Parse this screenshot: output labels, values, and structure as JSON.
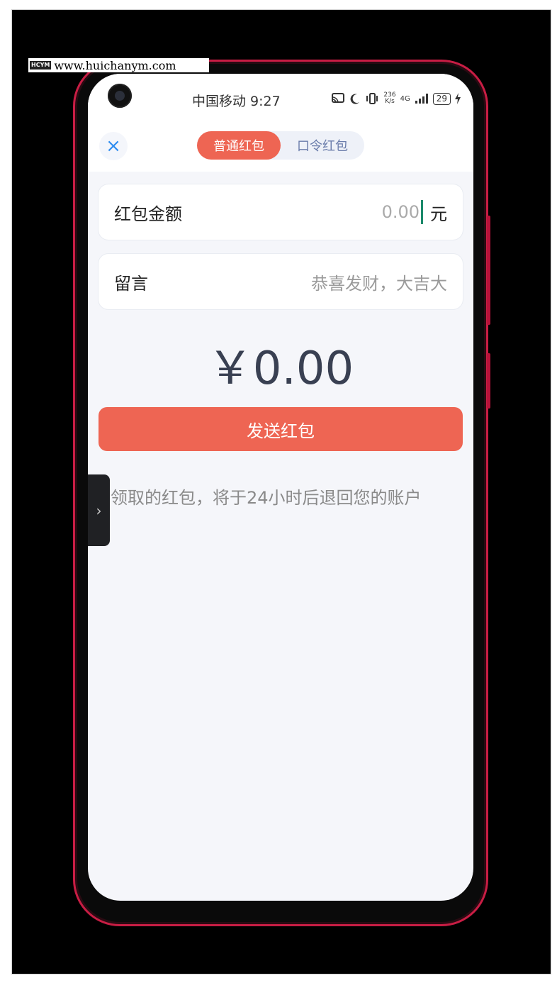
{
  "watermark": {
    "logo": "HCYM",
    "url": "www.huichanym.com"
  },
  "status_bar": {
    "carrier_time": "中国移动 9:27",
    "net_speed_value": "236",
    "net_speed_unit": "K/s",
    "network": "4G",
    "battery": "29"
  },
  "header": {
    "close_icon": "×",
    "tabs": [
      {
        "label": "普通红包",
        "active": true
      },
      {
        "label": "口令红包",
        "active": false
      }
    ]
  },
  "form": {
    "amount_label": "红包金额",
    "amount_value": "0.00",
    "amount_unit": "元",
    "message_label": "留言",
    "message_placeholder": "恭喜发财，大吉大"
  },
  "total": "￥0.00",
  "send_button": "发送红包",
  "hint": "未领取的红包，将于24小时后退回您的账户",
  "side_handle_icon": "›",
  "colors": {
    "accent": "#ee6553",
    "tab_inactive": "#6b7dab",
    "close": "#2f8df0"
  }
}
